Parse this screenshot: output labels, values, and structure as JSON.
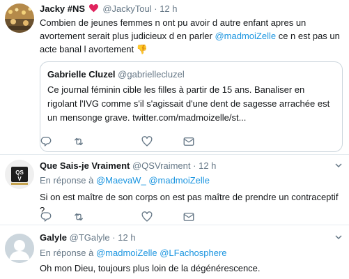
{
  "tweets": [
    {
      "name": "Jacky #NS",
      "handle": "@JackyToul",
      "sep": "·",
      "time": "12 h",
      "text_before": "Combien de jeunes femmes n ont pu avoir d autre enfant apres un avortement serait plus judicieux d en parler ",
      "mention": "@madmoiZelle",
      "text_after": " ce n est pas un acte banal l avortement ",
      "emoji": "👎",
      "quote": {
        "name": "Gabrielle Cluzel",
        "handle": "@gabriellecluzel",
        "text": "Ce journal féminin cible les filles à partir de 15 ans. Banaliser en rigolant l'IVG comme s'il s'agissait d'une dent de sagesse arrachée est un mensonge grave. twitter.com/madmoizelle/st..."
      }
    },
    {
      "name": "Que Sais-je Vraiment",
      "handle": "@QSVraiment",
      "sep": "·",
      "time": "12 h",
      "reply_prefix": "En réponse à",
      "reply_mentions": [
        "@MaevaW_",
        "@madmoiZelle"
      ],
      "text": "Si on est maître de son corps on est pas maître de prendre un contraceptif ?"
    },
    {
      "name": "Galyle",
      "handle": "@TGalyle",
      "sep": "·",
      "time": "12 h",
      "reply_prefix": "En réponse à",
      "reply_mentions": [
        "@madmoiZelle",
        "@LFachosphere"
      ],
      "text": "Oh mon Dieu, toujours plus loin de la dégénérescence."
    }
  ],
  "avatar_badge": "QS V",
  "icons": [
    "reply-icon",
    "retweet-icon",
    "like-icon",
    "message-icon",
    "heart-emoji-icon",
    "chevron-down-icon"
  ],
  "colors": {
    "link": "#1b95e0",
    "muted": "#657786",
    "heart": "#e0245e",
    "divider": "#e6ecf0"
  }
}
